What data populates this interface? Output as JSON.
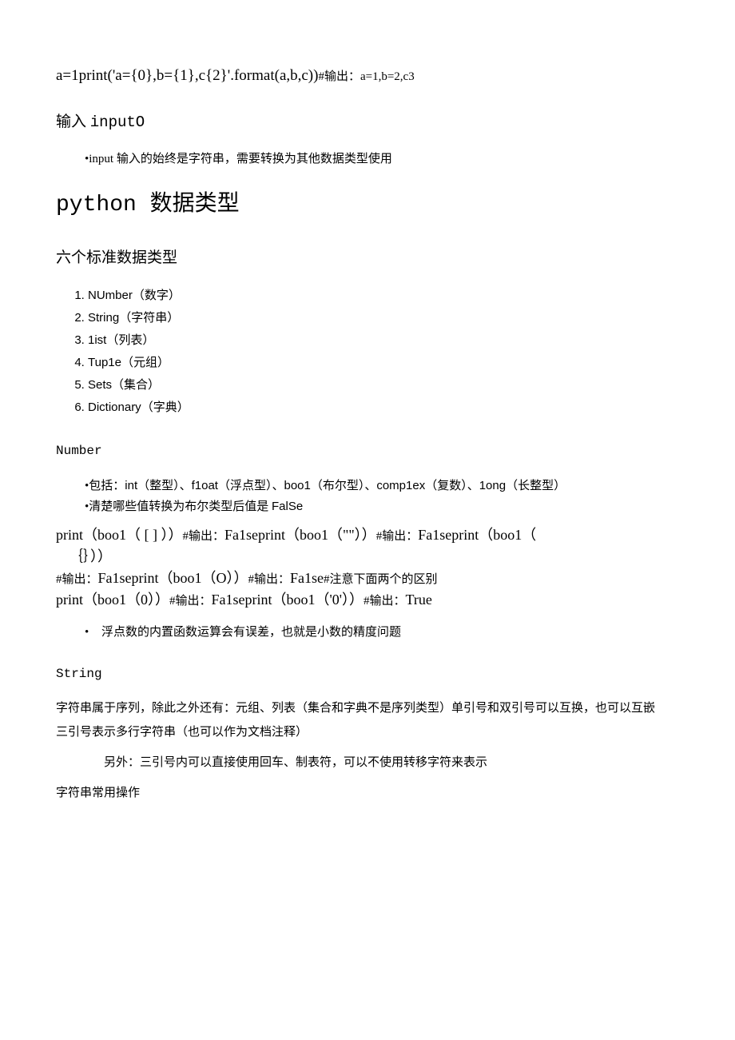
{
  "line1": {
    "code": "a=1print('a={0},b={1},c{2}'.format(a,b,c))",
    "out": "#输出：a=1,b=2,c3"
  },
  "input_heading": {
    "prefix": "输入 ",
    "mono": "inputO"
  },
  "input_note": "•input 输入的始终是字符串，需要转换为其他数据类型使用",
  "h1": {
    "mono": "python ",
    "cn": "数据类型"
  },
  "six_heading": "六个标准数据类型",
  "six_list": [
    {
      "en": "NUmber",
      "cn": "（数字）"
    },
    {
      "en": "String",
      "cn": "（字符串）"
    },
    {
      "en": "1ist",
      "cn": "（列表）"
    },
    {
      "en": "Tup1e",
      "cn": "（元组）"
    },
    {
      "en": "Sets",
      "cn": "（集合）"
    },
    {
      "en": "Dictionary",
      "cn": "（字典）"
    }
  ],
  "number_heading": "Number",
  "number_note1_a": "•包括：",
  "number_note1_b": "int（整型）、f1oat（浮点型）、boo1（布尔型）、comp1ex（复数）、1ong（长整型）",
  "number_note2_a": "•清楚哪些值转换为布尔类型后值是 ",
  "number_note2_b": "FalSe",
  "bool_block": {
    "l1a": "print（boo1（ [ ] ））",
    "l1b": "#输出：",
    "l1c": "Fa1seprint（boo1（\"\"））",
    "l1d": "#输出：",
    "l1e": "Fa1seprint（boo1（",
    "l2": "｛｝））",
    "l3a": "#输出：",
    "l3b": "Fa1seprint（boo1（O））",
    "l3c": "#输出：",
    "l3d": "Fa1se",
    "l3e": "#注意下面两个的区别",
    "l4a": "print（boo1（0））",
    "l4b": "#输出：",
    "l4c": "Fa1seprint（boo1（'0'））",
    "l4d": "#输出：",
    "l4e": "True"
  },
  "float_note": "浮点数的内置函数运算会有误差，也就是小数的精度问题",
  "string_heading": "String",
  "string_p1": "字符串属于序列，除此之外还有：元组、列表（集合和字典不是序列类型）单引号和双引号可以互换，也可以互嵌",
  "string_p2": "三引号表示多行字符串（也可以作为文档注释）",
  "string_p3": "另外：三引号内可以直接使用回车、制表符，可以不使用转移字符来表示",
  "string_ops_heading": "字符串常用操作"
}
